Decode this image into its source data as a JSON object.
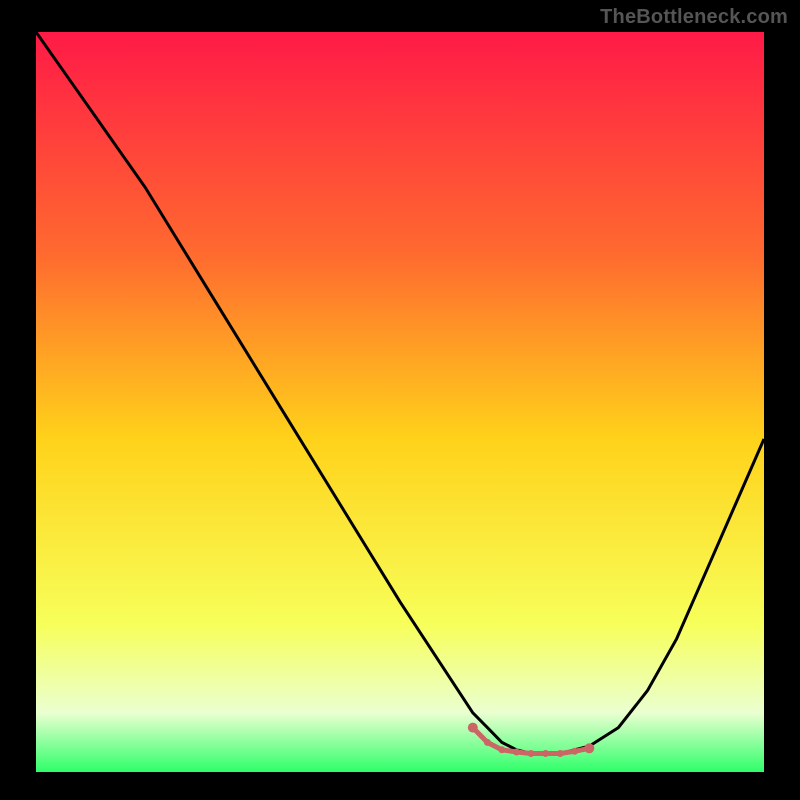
{
  "watermark": "TheBottleneck.com",
  "chart_data": {
    "type": "line",
    "title": "",
    "xlabel": "",
    "ylabel": "",
    "xlim": [
      0,
      100
    ],
    "ylim": [
      0,
      100
    ],
    "grid": false,
    "legend": false,
    "gradient_stops": [
      {
        "offset": 0,
        "color": "#ff1a47"
      },
      {
        "offset": 30,
        "color": "#ff6a2f"
      },
      {
        "offset": 55,
        "color": "#ffd21a"
      },
      {
        "offset": 80,
        "color": "#f7ff5a"
      },
      {
        "offset": 92,
        "color": "#eaffd0"
      },
      {
        "offset": 100,
        "color": "#2eff6a"
      }
    ],
    "series": [
      {
        "name": "bottleneck-curve",
        "stroke": "#000000",
        "x": [
          0,
          5,
          10,
          15,
          20,
          25,
          30,
          35,
          40,
          45,
          50,
          54,
          58,
          60,
          62,
          64,
          66,
          68,
          70,
          72,
          74,
          76,
          80,
          84,
          88,
          92,
          96,
          100
        ],
        "y": [
          100,
          93,
          86,
          79,
          71,
          63,
          55,
          47,
          39,
          31,
          23,
          17,
          11,
          8,
          6,
          4,
          3,
          2.5,
          2.5,
          2.5,
          3,
          3.5,
          6,
          11,
          18,
          27,
          36,
          45
        ]
      }
    ],
    "flat_region": {
      "color": "#cc6666",
      "points_x": [
        60,
        62,
        64,
        66,
        68,
        70,
        72,
        74,
        76
      ],
      "points_y": [
        6,
        4,
        3,
        2.7,
        2.5,
        2.5,
        2.5,
        2.8,
        3.2
      ]
    }
  }
}
